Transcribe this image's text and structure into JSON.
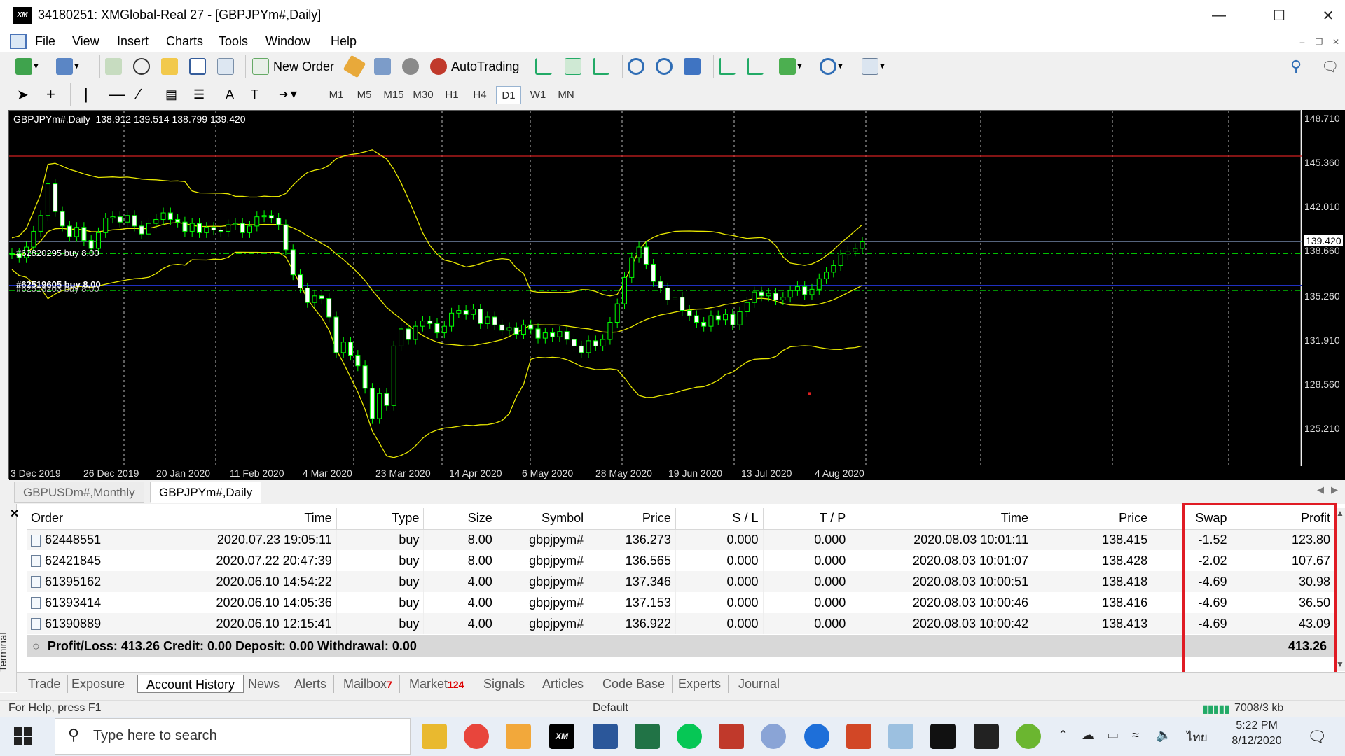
{
  "window": {
    "title": "34180251: XMGlobal-Real 27 - [GBPJPYm#,Daily]",
    "logo": "XM"
  },
  "menu": [
    "File",
    "View",
    "Insert",
    "Charts",
    "Tools",
    "Window",
    "Help"
  ],
  "toolbar": {
    "new_order": "New Order",
    "autotrading": "AutoTrading"
  },
  "timeframes": [
    "M1",
    "M5",
    "M15",
    "M30",
    "H1",
    "H4",
    "D1",
    "W1",
    "MN"
  ],
  "timeframe_active": "D1",
  "chart": {
    "header": "GBPJPYm#,Daily  138.912 139.514 138.799 139.420",
    "price_labels": [
      "148.710",
      "145.360",
      "142.010",
      "139.420",
      "138.660",
      "135.260",
      "131.910",
      "128.560",
      "125.210"
    ],
    "date_labels": [
      "3 Dec 2019",
      "26 Dec 2019",
      "20 Jan 2020",
      "11 Feb 2020",
      "4 Mar 2020",
      "23 Mar 2020",
      "14 Apr 2020",
      "6 May 2020",
      "28 May 2020",
      "19 Jun 2020",
      "13 Jul 2020",
      "4 Aug 2020"
    ],
    "order_label_1": "#62820295 buy 8.00",
    "order_label_2": "#62519605 buy 8.00",
    "order_label_3": "#62518203 buy 8.00",
    "colors": {
      "background": "#000000",
      "candles": "#00ff00",
      "bands": "#e8e800",
      "resistance": "#d02020",
      "order_line": "#00c000",
      "support": "#2030c0"
    }
  },
  "chart_tabs": [
    "GBPUSDm#,Monthly",
    "GBPJPYm#,Daily"
  ],
  "history": {
    "headers": [
      "Order",
      "Time",
      "Type",
      "Size",
      "Symbol",
      "Price",
      "S / L",
      "T / P",
      "Time",
      "Price",
      "Swap",
      "Profit"
    ],
    "rows": [
      [
        "62448551",
        "2020.07.23 19:05:11",
        "buy",
        "8.00",
        "gbpjpym#",
        "136.273",
        "0.000",
        "0.000",
        "2020.08.03 10:01:11",
        "138.415",
        "-1.52",
        "123.80"
      ],
      [
        "62421845",
        "2020.07.22 20:47:39",
        "buy",
        "8.00",
        "gbpjpym#",
        "136.565",
        "0.000",
        "0.000",
        "2020.08.03 10:01:07",
        "138.428",
        "-2.02",
        "107.67"
      ],
      [
        "61395162",
        "2020.06.10 14:54:22",
        "buy",
        "4.00",
        "gbpjpym#",
        "137.346",
        "0.000",
        "0.000",
        "2020.08.03 10:00:51",
        "138.418",
        "-4.69",
        "30.98"
      ],
      [
        "61393414",
        "2020.06.10 14:05:36",
        "buy",
        "4.00",
        "gbpjpym#",
        "137.153",
        "0.000",
        "0.000",
        "2020.08.03 10:00:46",
        "138.416",
        "-4.69",
        "36.50"
      ],
      [
        "61390889",
        "2020.06.10 12:15:41",
        "buy",
        "4.00",
        "gbpjpym#",
        "136.922",
        "0.000",
        "0.000",
        "2020.08.03 10:00:42",
        "138.413",
        "-4.69",
        "43.09"
      ]
    ],
    "summary": "Profit/Loss: 413.26  Credit: 0.00  Deposit: 0.00  Withdrawal: 0.00",
    "total_profit": "413.26"
  },
  "terminal_label": "Terminal",
  "bottom_tabs": [
    {
      "label": "Trade"
    },
    {
      "label": "Exposure"
    },
    {
      "label": "Account History",
      "active": true
    },
    {
      "label": "News"
    },
    {
      "label": "Alerts"
    },
    {
      "label": "Mailbox",
      "badge": "7"
    },
    {
      "label": "Market",
      "badge": "124"
    },
    {
      "label": "Signals"
    },
    {
      "label": "Articles"
    },
    {
      "label": "Code Base"
    },
    {
      "label": "Experts"
    },
    {
      "label": "Journal"
    }
  ],
  "status": {
    "help": "For Help, press F1",
    "profile": "Default",
    "traffic": "7008/3 kb"
  },
  "taskbar": {
    "search_placeholder": "Type here to search",
    "time": "5:22 PM",
    "date": "8/12/2020",
    "lang": "ไทย"
  }
}
